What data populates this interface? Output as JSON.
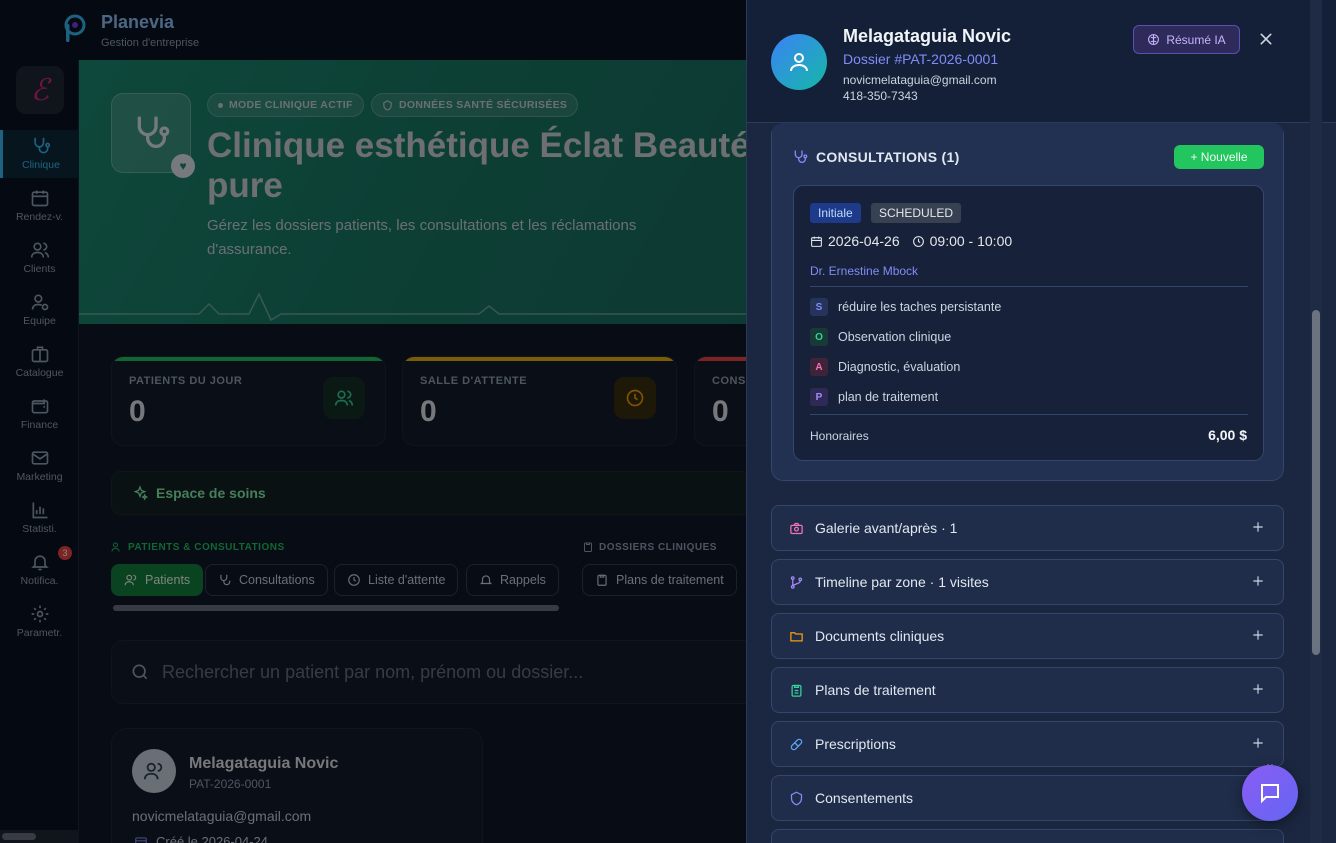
{
  "brand": {
    "name": "Planevia",
    "subtitle": "Gestion d'entreprise"
  },
  "sidebar": {
    "items": [
      {
        "label": "Clinique",
        "icon": "stethoscope-icon"
      },
      {
        "label": "Rendez-v.",
        "icon": "calendar-icon"
      },
      {
        "label": "Clients",
        "icon": "users-icon"
      },
      {
        "label": "Equipe",
        "icon": "user-gear-icon"
      },
      {
        "label": "Catalogue",
        "icon": "briefcase-icon"
      },
      {
        "label": "Finance",
        "icon": "wallet-icon"
      },
      {
        "label": "Marketing",
        "icon": "mail-icon"
      },
      {
        "label": "Statisti.",
        "icon": "bar-chart-icon"
      },
      {
        "label": "Notifica.",
        "icon": "bell-icon",
        "badge": "3"
      },
      {
        "label": "Parametr.",
        "icon": "gear-icon"
      }
    ]
  },
  "hero": {
    "pill_mode": "MODE CLINIQUE ACTIF",
    "pill_secure": "DONNÉES SANTÉ SÉCURISÉES",
    "title": "Clinique esthétique Éclat Beauté pure",
    "description": "Gérez les dossiers patients, les consultations et les réclamations d'assurance."
  },
  "stats": [
    {
      "label": "PATIENTS DU JOUR",
      "value": "0",
      "color": "#22c55e"
    },
    {
      "label": "SALLE D'ATTENTE",
      "value": "0",
      "color": "#eab308"
    },
    {
      "label": "CONSULTATIONS",
      "value": "0",
      "color": "#ef4444"
    }
  ],
  "care_space": {
    "label": "Espace de soins"
  },
  "sections": {
    "patients": "PATIENTS & CONSULTATIONS",
    "dossiers": "DOSSIERS CLINIQUES"
  },
  "tabs": {
    "patients": "Patients",
    "consultations": "Consultations",
    "waiting": "Liste d'attente",
    "reminders": "Rappels",
    "treatment_plans": "Plans de traitement"
  },
  "search": {
    "placeholder": "Rechercher un patient par nom, prénom ou dossier..."
  },
  "patient_card": {
    "name": "Melagataguia Novic",
    "id": "PAT-2026-0001",
    "email": "novicmelataguia@gmail.com",
    "created": "Créé le 2026-04-24"
  },
  "drawer": {
    "name": "Melagataguia Novic",
    "dossier": "Dossier #PAT-2026-0001",
    "email": "novicmelataguia@gmail.com",
    "phone": "418-350-7343",
    "ai_button": "Résumé IA",
    "consultations": {
      "title": "CONSULTATIONS (1)",
      "new_button": "+ Nouvelle",
      "entry": {
        "type": "Initiale",
        "status": "SCHEDULED",
        "date": "2026-04-26",
        "time": "09:00 - 10:00",
        "doctor": "Dr. Ernestine Mbock",
        "soap": [
          {
            "letter": "S",
            "text": "réduire les taches persistante",
            "color": "#818cf8"
          },
          {
            "letter": "O",
            "text": "Observation clinique",
            "color": "#34d399"
          },
          {
            "letter": "A",
            "text": "Diagnostic, évaluation",
            "color": "#f472b6"
          },
          {
            "letter": "P",
            "text": "plan de traitement",
            "color": "#a78bfa"
          }
        ],
        "fee_label": "Honoraires",
        "fee_value": "6,00 $"
      }
    },
    "accordions": [
      {
        "label": "Galerie avant/après · 1",
        "icon": "camera-icon",
        "color": "#f472b6"
      },
      {
        "label": "Timeline par zone · 1 visites",
        "icon": "git-branch-icon",
        "color": "#a78bfa"
      },
      {
        "label": "Documents cliniques",
        "icon": "folder-icon",
        "color": "#f59e0b"
      },
      {
        "label": "Plans de traitement",
        "icon": "clipboard-icon",
        "color": "#34d399"
      },
      {
        "label": "Prescriptions",
        "icon": "pill-icon",
        "color": "#60a5fa"
      },
      {
        "label": "Consentements",
        "icon": "shield-icon",
        "color": "#818cf8"
      }
    ]
  }
}
